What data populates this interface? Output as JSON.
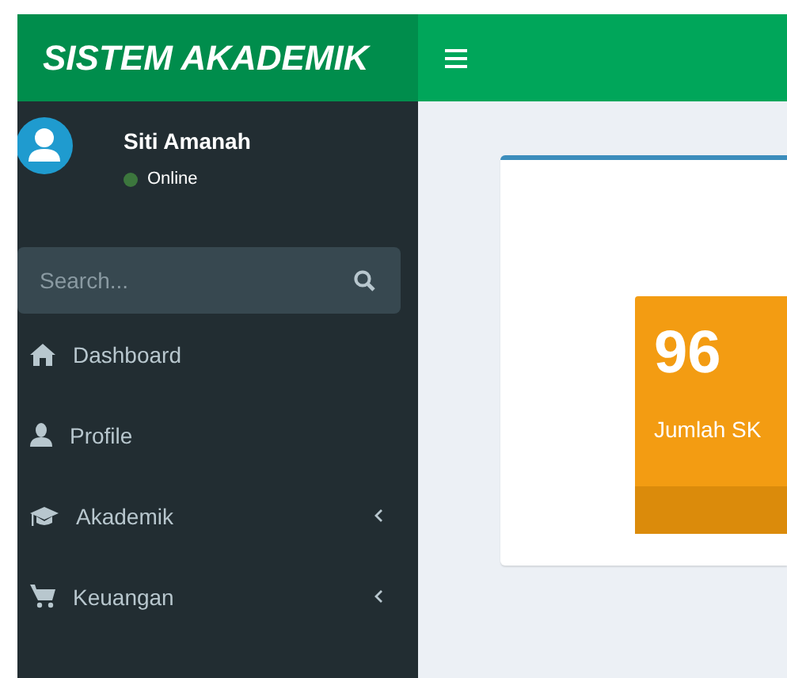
{
  "logo": "SISTEM AKADEMIK",
  "user": {
    "name": "Siti Amanah",
    "status": "Online"
  },
  "search": {
    "placeholder": "Search..."
  },
  "menu": [
    {
      "label": "Dashboard",
      "has_submenu": false
    },
    {
      "label": "Profile",
      "has_submenu": false
    },
    {
      "label": "Akademik",
      "has_submenu": true
    },
    {
      "label": "Keuangan",
      "has_submenu": true
    }
  ],
  "stat_box": {
    "value": "96",
    "label": "Jumlah SK"
  }
}
